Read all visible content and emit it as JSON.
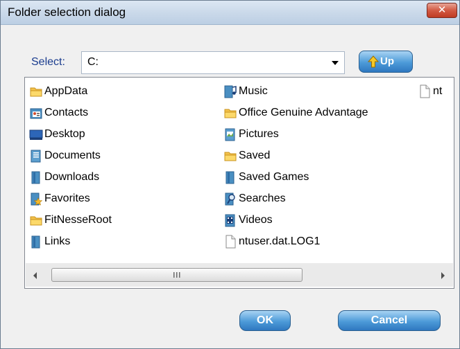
{
  "dialog": {
    "title": "Folder selection dialog",
    "close_label": "✕"
  },
  "selector": {
    "label": "Select:",
    "path_value": "C:",
    "up_label": "Up"
  },
  "file_list": {
    "items": [
      {
        "name": "AppData",
        "icon": "folder-icon"
      },
      {
        "name": "Contacts",
        "icon": "contacts-folder-icon"
      },
      {
        "name": "Desktop",
        "icon": "desktop-icon"
      },
      {
        "name": "Documents",
        "icon": "documents-folder-icon"
      },
      {
        "name": "Downloads",
        "icon": "downloads-folder-icon"
      },
      {
        "name": "Favorites",
        "icon": "favorites-folder-icon"
      },
      {
        "name": "FitNesseRoot",
        "icon": "folder-icon"
      },
      {
        "name": "Links",
        "icon": "links-folder-icon"
      },
      {
        "name": "Music",
        "icon": "music-folder-icon"
      },
      {
        "name": "Office Genuine Advantage",
        "icon": "folder-icon"
      },
      {
        "name": "Pictures",
        "icon": "pictures-folder-icon"
      },
      {
        "name": "Saved",
        "icon": "folder-icon"
      },
      {
        "name": "Saved Games",
        "icon": "saved-games-folder-icon"
      },
      {
        "name": "Searches",
        "icon": "searches-folder-icon"
      },
      {
        "name": "Videos",
        "icon": "videos-folder-icon"
      },
      {
        "name": "ntuser.dat.LOG1",
        "icon": "file-icon"
      },
      {
        "name": "nt",
        "icon": "file-icon"
      }
    ]
  },
  "scrollbar": {
    "grip_glyph": "III"
  },
  "buttons": {
    "ok_label": "OK",
    "cancel_label": "Cancel"
  },
  "colors": {
    "accent": "#3d86cb",
    "title_bar": "#c9d8e9",
    "close_red": "#c8442a",
    "label_blue": "#1a3c8e"
  }
}
